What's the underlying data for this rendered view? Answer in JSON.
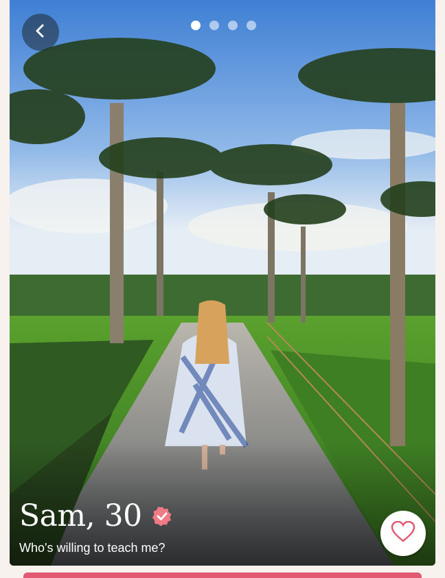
{
  "profile": {
    "name_age": "Sam, 30",
    "prompt": "Who's willing to teach me?",
    "photo_count": 4,
    "active_photo_index": 0
  },
  "icons": {
    "back": "chevron-left-icon",
    "verified": "verified-badge-icon",
    "like": "heart-icon"
  },
  "colors": {
    "accent": "#e25a72",
    "verified_badge": "#f07a86"
  }
}
